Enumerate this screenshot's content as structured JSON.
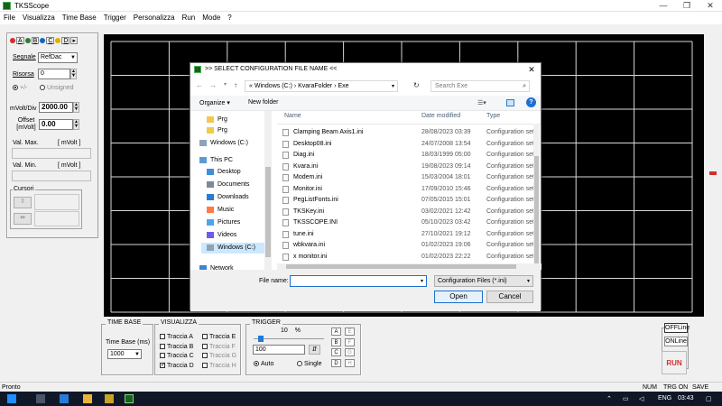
{
  "window": {
    "title": "TKSScope",
    "min": "—",
    "max": "❐",
    "close": "✕"
  },
  "menu": [
    "File",
    "Visualizza",
    "Time Base",
    "Trigger",
    "Personalizza",
    "Run",
    "Mode",
    "?"
  ],
  "channels": [
    {
      "label": "A",
      "color": "#d32f2f"
    },
    {
      "label": "B",
      "color": "#2e7d32"
    },
    {
      "label": "C",
      "color": "#1565c0"
    },
    {
      "label": "D",
      "color": "#e0b000"
    }
  ],
  "channel_arrow": "▸",
  "left": {
    "segnale_label": "Segnale",
    "segnale_value": "RefDac",
    "risorsa_label": "Risorsa",
    "risorsa_value": "0",
    "plusminus": "+/-",
    "unsigned": "Unsigned",
    "mvolt_label": "mVolt/Div",
    "mvolt_value": "2000.00",
    "offset_label": "Offset [mVolt]",
    "offset_value": "0.00",
    "valmax_label": "Val. Max.",
    "valmax_unit": "[ mVolt ]",
    "valmin_label": "Val. Min.",
    "valmin_unit": "[ mVolt ]",
    "cursori_label": "Cursori"
  },
  "timebase": {
    "title": "TIME BASE",
    "label": "Time Base (ms)",
    "value": "1000"
  },
  "visualizza": {
    "title": "VISUALIZZA",
    "items": [
      {
        "label": "Traccia A",
        "checked": false,
        "enabled": true
      },
      {
        "label": "Traccia E",
        "checked": false,
        "enabled": true
      },
      {
        "label": "Traccia B",
        "checked": false,
        "enabled": true
      },
      {
        "label": "Traccia F",
        "checked": false,
        "enabled": false
      },
      {
        "label": "Traccia C",
        "checked": false,
        "enabled": true
      },
      {
        "label": "Traccia G",
        "checked": false,
        "enabled": false
      },
      {
        "label": "Traccia D",
        "checked": true,
        "enabled": true
      },
      {
        "label": "Traccia H",
        "checked": false,
        "enabled": false
      }
    ]
  },
  "trigger": {
    "title": "TRIGGER",
    "percent": "10",
    "percent_unit": "%",
    "value": "100",
    "auto": "Auto",
    "single": "Single",
    "letters": [
      "A",
      "E",
      "B",
      "F",
      "C",
      "G",
      "D",
      "H"
    ]
  },
  "right": {
    "offline": "OFFLine",
    "online": "ONLine",
    "run": "RUN"
  },
  "status": {
    "left": "Pronto",
    "indicators": [
      "NUM",
      "TRG ON",
      "SAVE OFF"
    ]
  },
  "taskbar": {
    "lang": "ENG",
    "time": "03:43"
  },
  "dialog": {
    "title": ">> SELECT CONFIGURATION FILE NAME <<",
    "close": "✕",
    "path": [
      "«",
      "Windows (C:)",
      "›",
      "KvaraFolder",
      "›",
      "Exe"
    ],
    "search_placeholder": "Search Exe",
    "organize": "Organize ▾",
    "new_folder": "New folder",
    "tree": [
      {
        "label": "Prg",
        "icon": "folder"
      },
      {
        "label": "Prg",
        "icon": "folder"
      },
      {
        "label": "Windows (C:)",
        "icon": "drive"
      },
      {
        "label": "This PC",
        "icon": "pc"
      },
      {
        "label": "Desktop",
        "icon": "desktop"
      },
      {
        "label": "Documents",
        "icon": "documents"
      },
      {
        "label": "Downloads",
        "icon": "downloads"
      },
      {
        "label": "Music",
        "icon": "music"
      },
      {
        "label": "Pictures",
        "icon": "pictures"
      },
      {
        "label": "Videos",
        "icon": "videos"
      },
      {
        "label": "Windows (C:)",
        "icon": "drive"
      },
      {
        "label": "Network",
        "icon": "network"
      }
    ],
    "columns": [
      "Name",
      "Date modified",
      "Type"
    ],
    "files": [
      {
        "name": "Clamping Beam Axis1.ini",
        "date": "28/08/2023 03:39",
        "type": "Configuration set"
      },
      {
        "name": "Desktop08.ini",
        "date": "24/07/2008 13:54",
        "type": "Configuration set"
      },
      {
        "name": "Diag.ini",
        "date": "18/03/1999 05:00",
        "type": "Configuration set"
      },
      {
        "name": "Kvara.ini",
        "date": "19/08/2023 09:14",
        "type": "Configuration set"
      },
      {
        "name": "Modem.ini",
        "date": "15/03/2004 18:01",
        "type": "Configuration set"
      },
      {
        "name": "Monitor.ini",
        "date": "17/09/2010 15:46",
        "type": "Configuration set"
      },
      {
        "name": "PegListFonts.ini",
        "date": "07/05/2015 15:01",
        "type": "Configuration set"
      },
      {
        "name": "TKSKey.ini",
        "date": "03/02/2021 12:42",
        "type": "Configuration set"
      },
      {
        "name": "TKSSCOPE.INI",
        "date": "05/10/2023 03:42",
        "type": "Configuration set"
      },
      {
        "name": "tune.ini",
        "date": "27/10/2021 19:12",
        "type": "Configuration set"
      },
      {
        "name": "wbkvara.ini",
        "date": "01/02/2023 19:06",
        "type": "Configuration set"
      },
      {
        "name": "x monitor.ini",
        "date": "01/02/2023 22:22",
        "type": "Configuration set"
      }
    ],
    "filename_label": "File name:",
    "filename_value": "",
    "filetype": "Configuration Files (*.ini)",
    "open": "Open",
    "cancel": "Cancel"
  }
}
